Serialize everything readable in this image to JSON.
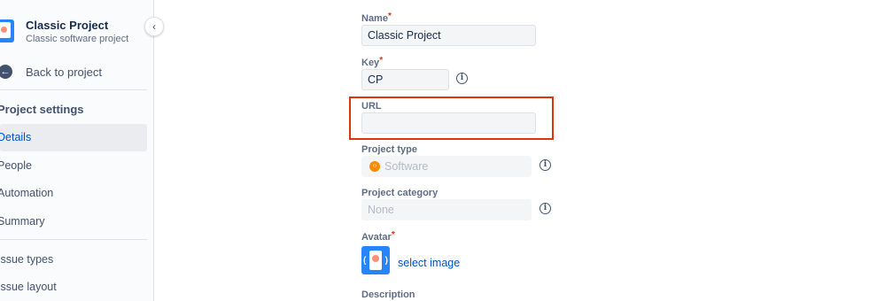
{
  "sidebar": {
    "project_name": "Classic Project",
    "project_subtitle": "Classic software project",
    "back_label": "Back to project",
    "section_title": "Project settings",
    "items": [
      {
        "label": "Details",
        "active": true
      },
      {
        "label": "People",
        "active": false
      },
      {
        "label": "Automation",
        "active": false
      },
      {
        "label": "Summary",
        "active": false
      },
      {
        "label": "Issue types",
        "active": false
      },
      {
        "label": "Issue layout",
        "active": false
      }
    ],
    "collapse_icon": "chevron-left-icon"
  },
  "form": {
    "name": {
      "label": "Name",
      "required": "*",
      "value": "Classic Project"
    },
    "key": {
      "label": "Key",
      "required": "*",
      "value": "CP"
    },
    "url": {
      "label": "URL",
      "value": ""
    },
    "project_type": {
      "label": "Project type",
      "value": "Software"
    },
    "project_category": {
      "label": "Project category",
      "placeholder": "None"
    },
    "avatar": {
      "label": "Avatar",
      "required": "*",
      "link": "select image"
    },
    "description": {
      "label": "Description"
    }
  },
  "colors": {
    "accent": "#0052cc",
    "required": "#de350b",
    "highlight": "#de350b",
    "software_badge": "#ff8b00"
  }
}
